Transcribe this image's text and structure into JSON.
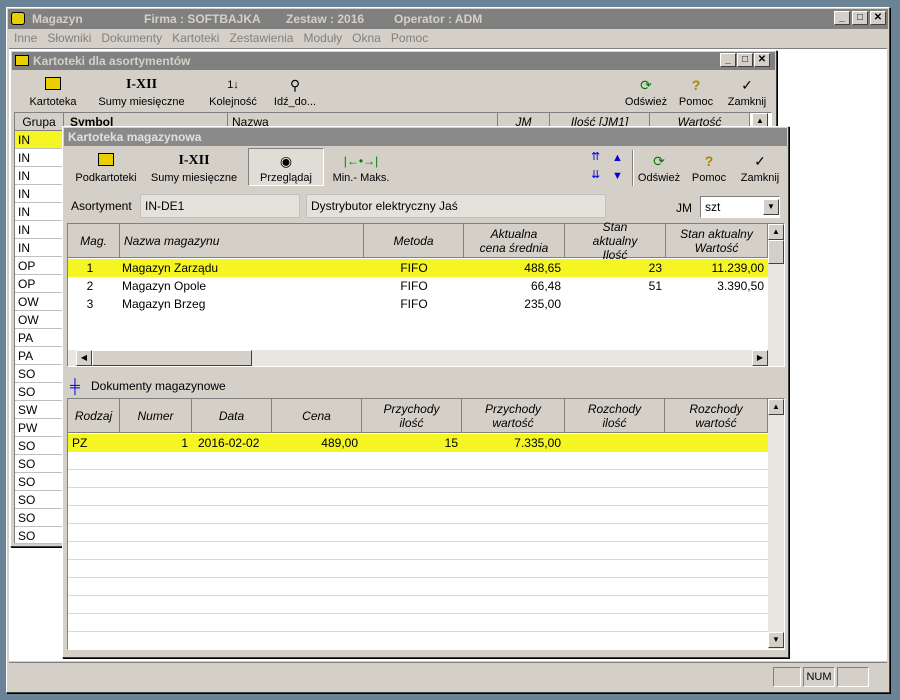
{
  "app": {
    "title": "Magazyn",
    "firma": "Firma : SOFTBAJKA",
    "zestaw": "Zestaw : 2016",
    "operator": "Operator : ADM"
  },
  "menu": [
    "Inne",
    "Słowniki",
    "Dokumenty",
    "Kartoteki",
    "Zestawienia",
    "Moduły",
    "Okna",
    "Pomoc"
  ],
  "back_window": {
    "title": "Kartoteki dla asortymentów",
    "toolbar": {
      "kartoteka": "Kartoteka",
      "sumy": "Sumy miesięczne",
      "sumy_icon": "I-XII",
      "kolejnosc": "Kolejność",
      "idz": "Idź_do...",
      "odswiez": "Odśwież",
      "pomoc": "Pomoc",
      "zamknij": "Zamknij"
    },
    "headers": {
      "grupa": "Grupa",
      "symbol": "Symbol",
      "nazwa": "Nazwa",
      "jm": "JM",
      "ilosc": "Ilość [JM1]",
      "wartosc": "Wartość"
    },
    "groups": [
      "IN",
      "IN",
      "IN",
      "IN",
      "IN",
      "IN",
      "IN",
      "OP",
      "OP",
      "OW",
      "OW",
      "PA",
      "PA",
      "SO",
      "SO",
      "SW",
      "PW",
      "SO",
      "SO",
      "SO",
      "SO",
      "SO",
      "SO"
    ]
  },
  "front_window": {
    "title": "Kartoteka magazynowa",
    "toolbar": {
      "podkartoteki": "Podkartoteki",
      "sumy": "Sumy miesięczne",
      "sumy_icon": "I-XII",
      "przegladaj": "Przeglądaj",
      "minmax": "Min.- Maks.",
      "odswiez": "Odśwież",
      "pomoc": "Pomoc",
      "zamknij": "Zamknij"
    },
    "asortyment_label": "Asortyment",
    "asortyment_code": "IN-DE1",
    "asortyment_name": "Dystrybutor elektryczny Jaś",
    "jm_label": "JM",
    "jm_value": "szt",
    "warehouse_headers": [
      "Mag.",
      "Nazwa magazynu",
      "Metoda",
      "Aktualna cena średnia",
      "Stan aktualny Ilość",
      "Stan aktualny Wartość"
    ],
    "warehouses": [
      {
        "mag": "1",
        "nazwa": "Magazyn Zarządu",
        "metoda": "FIFO",
        "cena": "488,65",
        "ilosc": "23",
        "wartosc": "11.239,00"
      },
      {
        "mag": "2",
        "nazwa": "Magazyn Opole",
        "metoda": "FIFO",
        "cena": "66,48",
        "ilosc": "51",
        "wartosc": "3.390,50"
      },
      {
        "mag": "3",
        "nazwa": "Magazyn Brzeg",
        "metoda": "FIFO",
        "cena": "235,00",
        "ilosc": "",
        "wartosc": ""
      }
    ],
    "docs_title": "Dokumenty magazynowe",
    "doc_headers": [
      "Rodzaj",
      "Numer",
      "Data",
      "Cena",
      "Przychody ilość",
      "Przychody wartość",
      "Rozchody ilość",
      "Rozchody wartość"
    ],
    "docs": [
      {
        "rodzaj": "PZ",
        "numer": "1",
        "data": "2016-02-02",
        "cena": "489,00",
        "p_ilosc": "15",
        "p_wartosc": "7.335,00",
        "r_ilosc": "",
        "r_wartosc": ""
      }
    ]
  },
  "statusbar": {
    "num": "NUM"
  },
  "colors": {
    "highlight": "#f5f523",
    "desktop": "#6b8396",
    "face": "#d4d0c8"
  }
}
